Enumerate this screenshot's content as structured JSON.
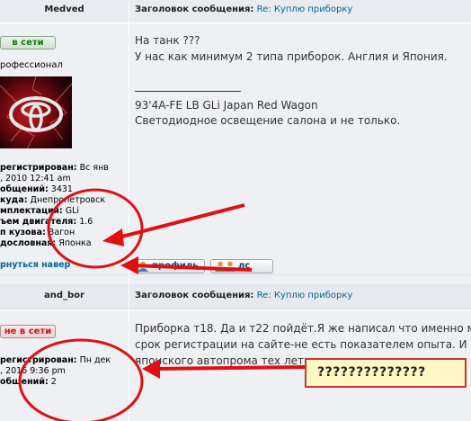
{
  "post1": {
    "author": "Medved",
    "subject_label": "Заголовок сообщения:",
    "subject_title": "Re: Куплю приборку",
    "status": "в сети",
    "rank": "рофессионал",
    "info": [
      {
        "label": "регистрирован:",
        "value": " Вс янв"
      },
      {
        "label": "",
        "value": ", 2010 12:41 am"
      },
      {
        "label": "общений:",
        "value": " 3431"
      },
      {
        "label": "куда:",
        "value": " Днепропетровск"
      },
      {
        "label": "мплектация:",
        "value": " GLi"
      },
      {
        "label": "ъем двигателя:",
        "value": " 1.6"
      },
      {
        "label": "п кузова:",
        "value": " Вагон"
      },
      {
        "label": "дословная:",
        "value": " Японка"
      }
    ],
    "back_link": "рнуться навер",
    "message_lines": [
      "На танк ???",
      "У нас как минимум 2 типа приборок. Англия и Япония."
    ],
    "signature_text": "93'4A-FE LB GLi Japan Red Wagon",
    "signature_link": "Светодиодное освещение салона и не только.",
    "buttons": {
      "profile": "профиль",
      "pm": "лс"
    }
  },
  "post2": {
    "author": "and_bor",
    "subject_label": "Заголовок сообщения:",
    "subject_title": "Re: Куплю приборку",
    "status": "не в сети",
    "info": [
      {
        "label": "регистрирован:",
        "value": " Пн дек"
      },
      {
        "label": "",
        "value": ", 2016 9:36 pm"
      },
      {
        "label": "общений:",
        "value": " 2"
      }
    ],
    "message_lines": [
      "Приборка т18. Да и т22 пойдёт.Я же написал что именно мне",
      "срок регистрации на сайте-не есть показателем опыта. И воо",
      "японского автопрома тех лет"
    ]
  },
  "annotation": {
    "question_box": "??????????????",
    "annotation_color": "#e01010"
  }
}
